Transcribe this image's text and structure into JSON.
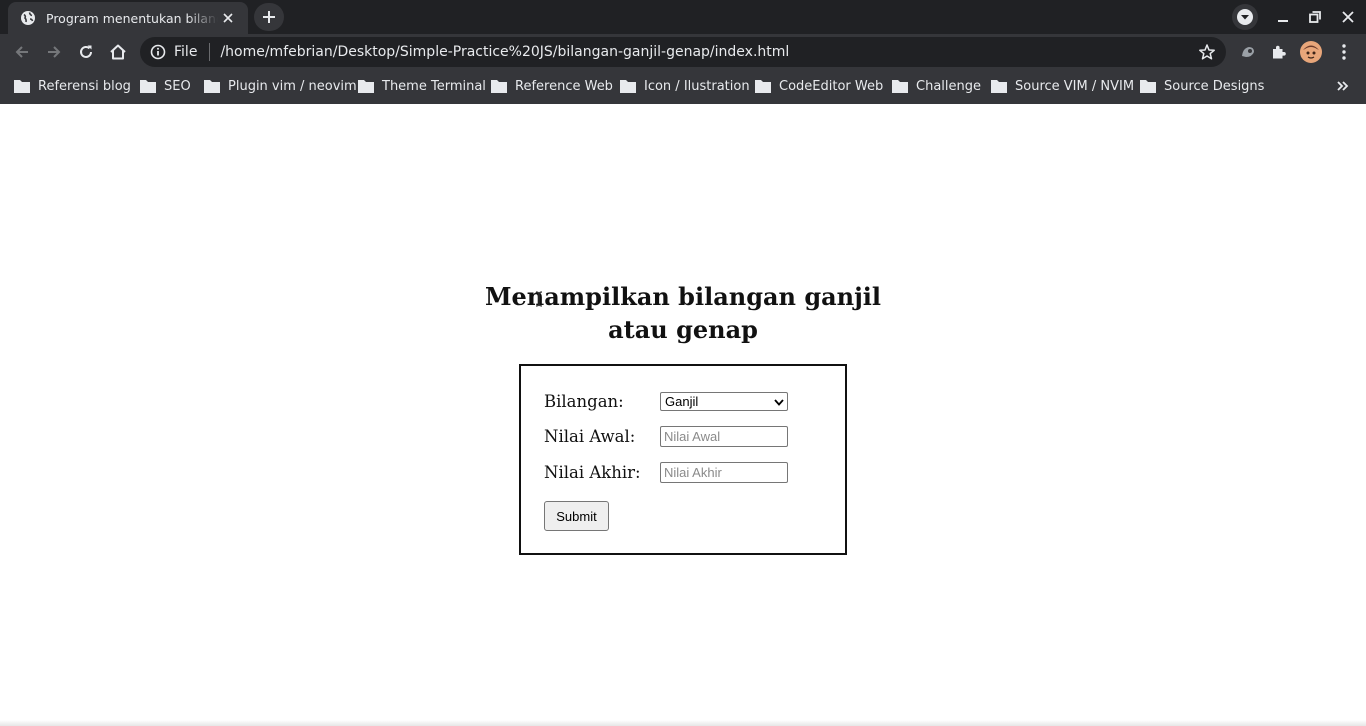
{
  "browser": {
    "tab_title": "Program menentukan bilangan ganjil atau genap",
    "omnibox_scheme": "File",
    "url": "/home/mfebrian/Desktop/Simple-Practice%20JS/bilangan-ganjil-genap/index.html"
  },
  "bookmarks": [
    {
      "label": "Referensi blog"
    },
    {
      "label": "SEO"
    },
    {
      "label": "Plugin vim / neovim"
    },
    {
      "label": "Theme Terminal"
    },
    {
      "label": "Reference Web"
    },
    {
      "label": "Icon / Ilustration"
    },
    {
      "label": "CodeEditor Web"
    },
    {
      "label": "Challenge"
    },
    {
      "label": "Source VIM / NVIM"
    },
    {
      "label": "Source Designs"
    }
  ],
  "page": {
    "heading_line1": "Menampilkan bilangan ganjil",
    "heading_line2": "atau genap",
    "form": {
      "bilangan_label": "Bilangan:",
      "bilangan_selected": "Ganjil",
      "nilai_awal_label": "Nilai Awal:",
      "nilai_awal_placeholder": "Nilai Awal",
      "nilai_akhir_label": "Nilai Akhir:",
      "nilai_akhir_placeholder": "Nilai Akhir",
      "submit_label": "Submit"
    }
  },
  "icons": {
    "tab_favicon": "globe-icon",
    "tab_close": "close-icon",
    "new_tab": "plus-icon",
    "tab_search": "chevron-down-icon",
    "minimize": "minimize-icon",
    "restore": "restore-icon",
    "close_window": "close-icon",
    "back": "arrow-left-icon",
    "forward": "arrow-right-icon",
    "reload": "reload-icon",
    "home": "home-icon",
    "site_info": "info-icon",
    "bookmark_star": "star-icon",
    "extensions": "puzzle-icon",
    "menu": "kebab-menu-icon",
    "bookmark_overflow": "double-chevron-right-icon"
  },
  "colors": {
    "titlebar": "#202124",
    "toolbar": "#35363a",
    "omnibox": "#202124",
    "chrome_text": "#e8eaed",
    "page_background": "#ffffff"
  }
}
